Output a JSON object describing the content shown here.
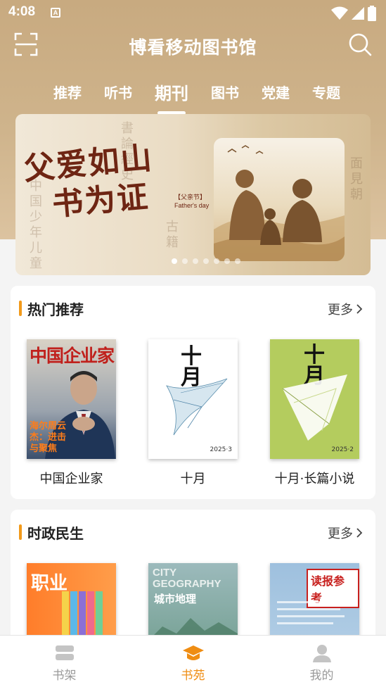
{
  "status_bar": {
    "time": "4:08",
    "notification": "A"
  },
  "header": {
    "title": "博看移动图书馆"
  },
  "tabs": [
    {
      "label": "推荐"
    },
    {
      "label": "听书"
    },
    {
      "label": "期刊",
      "active": true
    },
    {
      "label": "图书"
    },
    {
      "label": "党建"
    },
    {
      "label": "专题"
    }
  ],
  "banner": {
    "headline_line1": "父爱如山",
    "headline_line2": "书为证",
    "tag_cn": "【父亲节】",
    "tag_en": "Father's day",
    "slide_count": 7,
    "active_slide": 1
  },
  "section_hot": {
    "title": "热门推荐",
    "more": "更多",
    "books": [
      {
        "title": "中国企业家",
        "cover_masthead": "中国企业家",
        "cover_tagline": "海尔周云杰：进击与聚焦"
      },
      {
        "title": "十月",
        "cover_masthead": "十月",
        "cover_issue": "2025·3"
      },
      {
        "title": "十月·长篇小说",
        "cover_masthead": "十月",
        "cover_issue": "2025·2"
      }
    ]
  },
  "section_politics": {
    "title": "时政民生",
    "more": "更多",
    "books": [
      {
        "cover_masthead": "职业"
      },
      {
        "cover_masthead": "CITY GEOGRAPHY",
        "cover_subtitle": "城市地理"
      },
      {
        "cover_masthead": "读报参考"
      }
    ]
  },
  "bottom_nav": [
    {
      "label": "书架",
      "icon": "bookshelf-icon"
    },
    {
      "label": "书苑",
      "icon": "graduation-cap-icon",
      "active": true
    },
    {
      "label": "我的",
      "icon": "user-icon"
    }
  ],
  "colors": {
    "accent": "#ef8d13",
    "section_bar": "#f29a1b",
    "header_bg": "#c8aa80",
    "banner_title": "#6e2513"
  }
}
